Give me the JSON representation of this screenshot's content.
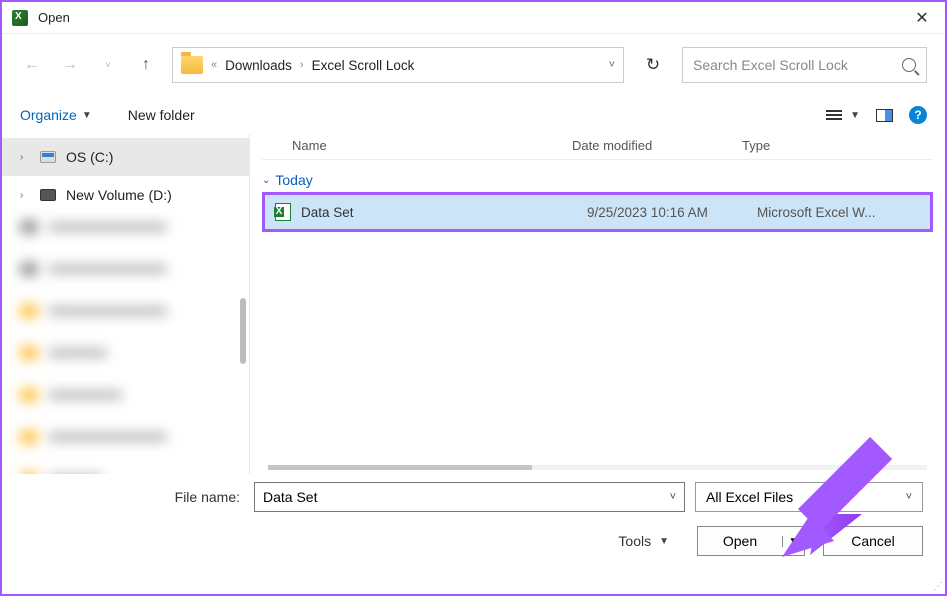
{
  "window": {
    "title": "Open"
  },
  "nav": {
    "breadcrumb": {
      "sep": "«",
      "item1": "Downloads",
      "item2": "Excel Scroll Lock"
    },
    "search_placeholder": "Search Excel Scroll Lock"
  },
  "toolbar": {
    "organize": "Organize",
    "newfolder": "New folder",
    "help": "?"
  },
  "sidebar": {
    "drives": [
      {
        "label": "OS (C:)"
      },
      {
        "label": "New Volume (D:)"
      }
    ]
  },
  "columns": {
    "name": "Name",
    "date": "Date modified",
    "type": "Type"
  },
  "group": {
    "today": "Today"
  },
  "files": [
    {
      "name": "Data Set",
      "date": "9/25/2023 10:16 AM",
      "type": "Microsoft Excel W..."
    }
  ],
  "bottom": {
    "filename_label": "File name:",
    "filename_value": "Data Set",
    "filetype_value": "All Excel Files",
    "tools": "Tools",
    "open": "Open",
    "cancel": "Cancel"
  }
}
